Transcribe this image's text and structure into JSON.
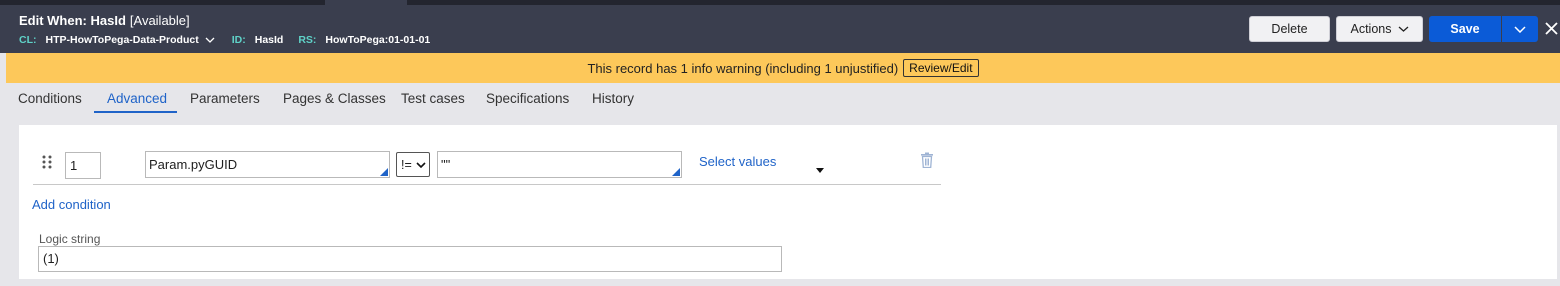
{
  "header": {
    "title": "Edit  When: HasId",
    "status": "[Available]",
    "class_label": "CL:",
    "class_value": "HTP-HowToPega-Data-Product",
    "id_label": "ID:",
    "id_value": "HasId",
    "rs_label": "RS:",
    "rs_value": "HowToPega:01-01-01",
    "delete_label": "Delete",
    "actions_label": "Actions",
    "save_label": "Save"
  },
  "banner": {
    "message": "This record has 1 info warning (including 1 unjustified)",
    "review_label": "Review/Edit"
  },
  "tabs": [
    {
      "label": "Conditions"
    },
    {
      "label": "Advanced"
    },
    {
      "label": "Parameters"
    },
    {
      "label": "Pages & Classes"
    },
    {
      "label": "Test cases"
    },
    {
      "label": "Specifications"
    },
    {
      "label": "History"
    }
  ],
  "active_tab": "Advanced",
  "condition": {
    "number": "1",
    "left_operand": "Param.pyGUID",
    "operator": "!=",
    "right_operand": "\"\"",
    "select_values_label": "Select values"
  },
  "add_condition_label": "Add condition",
  "logic": {
    "label": "Logic string",
    "value": "(1)"
  },
  "colors": {
    "header_bg": "#3a3e4e",
    "accent_teal": "#5fd2c8",
    "primary_blue": "#0b5bd7",
    "link_blue": "#1f63c8",
    "warning_bg": "#fdc85a"
  }
}
